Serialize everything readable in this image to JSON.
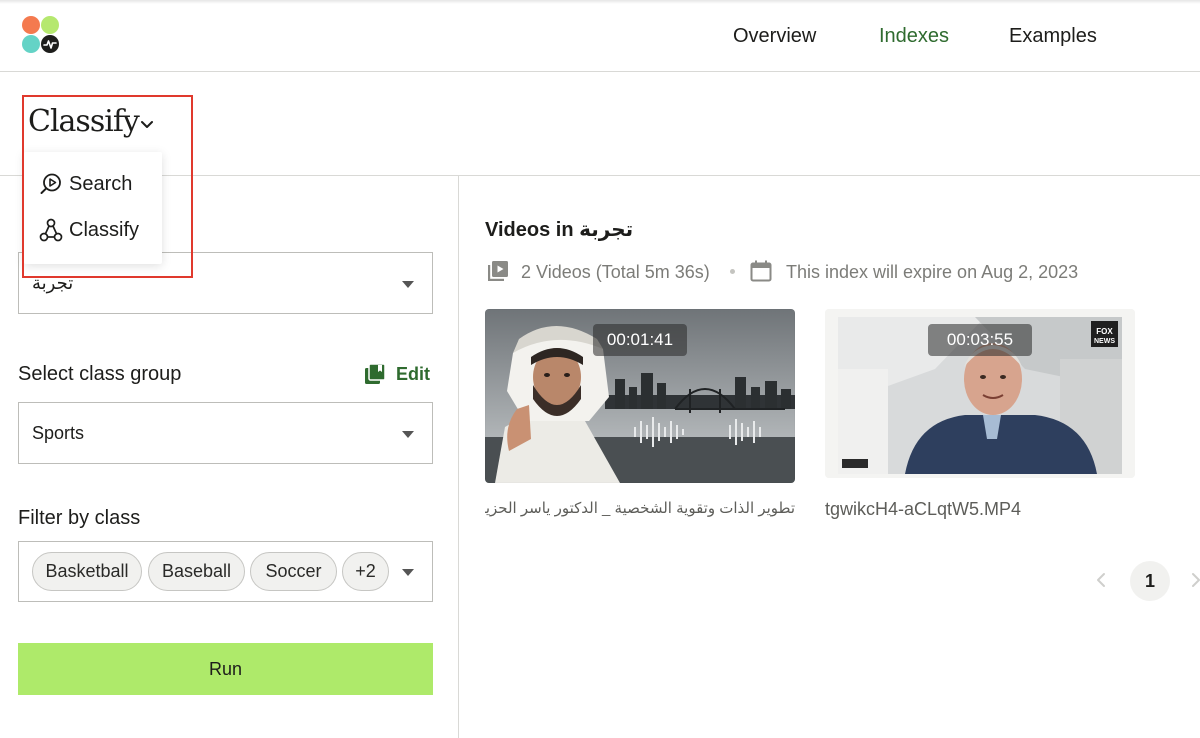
{
  "header": {
    "logo_colors": [
      "#f47a4f",
      "#b5e86f",
      "#64d3c6",
      "#1d1d1b"
    ],
    "nav": [
      {
        "label": "Overview"
      },
      {
        "label": "Indexes"
      },
      {
        "label": "Examples"
      }
    ],
    "active_nav": "Indexes",
    "active_color": "#2f6b2f"
  },
  "page": {
    "title": "Classify",
    "dropdown_open": true,
    "menu": [
      {
        "label": "Search",
        "icon": "search-video-icon"
      },
      {
        "label": "Classify",
        "icon": "classify-nodes-icon"
      }
    ]
  },
  "form": {
    "index_value": "تجربة",
    "class_group_heading": "Select class group",
    "edit_label": "Edit",
    "class_group_value": "Sports",
    "filter_heading": "Filter by class",
    "classes": [
      "Basketball",
      "Baseball",
      "Soccer",
      "+2"
    ],
    "run_label": "Run",
    "run_color": "#aeea6a"
  },
  "videos": {
    "heading_prefix": "Videos in ",
    "index_name": "تجربة",
    "count_text": "2 Videos (Total 5m 36s)",
    "expiry_text": "This index will expire on Aug 2, 2023",
    "items": [
      {
        "duration": "00:01:41",
        "title": "تطوير الذات وتقوية الشخصية _ الدكتور ياسر الحزيمي"
      },
      {
        "duration": "00:03:55",
        "title": "tgwikcH4-aCLqtW5.MP4"
      }
    ]
  },
  "pagination": {
    "current_page": "1"
  },
  "annotation": {
    "highlight_color": "#e0392d"
  }
}
